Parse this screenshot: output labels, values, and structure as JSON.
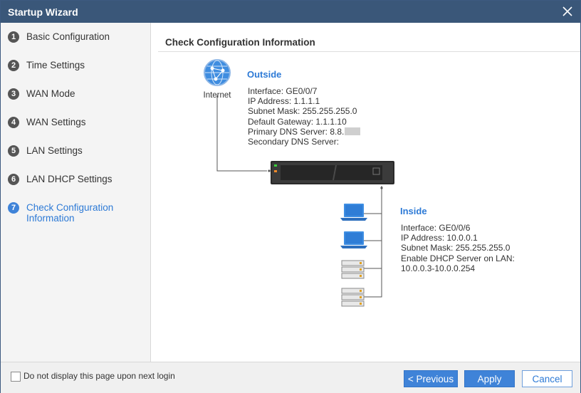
{
  "window": {
    "title": "Startup Wizard"
  },
  "steps": [
    {
      "num": "1",
      "label": "Basic Configuration"
    },
    {
      "num": "2",
      "label": "Time Settings"
    },
    {
      "num": "3",
      "label": "WAN Mode"
    },
    {
      "num": "4",
      "label": "WAN Settings"
    },
    {
      "num": "5",
      "label": "LAN Settings"
    },
    {
      "num": "6",
      "label": "LAN DHCP Settings"
    },
    {
      "num": "7",
      "label": "Check Configuration Information",
      "active": true
    }
  ],
  "main": {
    "section_title": "Check Configuration Information",
    "internet_label": "Internet",
    "outside": {
      "heading": "Outside",
      "interface": "Interface: GE0/0/7",
      "ip": "IP Address: 1.1.1.1",
      "mask": "Subnet Mask: 255.255.255.0",
      "gateway": "Default Gateway: 1.1.1.10",
      "primary_dns": "Primary DNS Server: 8.8.",
      "secondary_dns": "Secondary DNS Server:"
    },
    "inside": {
      "heading": "Inside",
      "interface": "Interface: GE0/0/6",
      "ip": "IP Address: 10.0.0.1",
      "mask": "Subnet Mask: 255.255.255.0",
      "dhcp": "Enable DHCP Server on LAN:",
      "range": "10.0.0.3-10.0.0.254"
    }
  },
  "footer": {
    "dont_show_label": "Do not display this page upon next login",
    "previous_label": "< Previous",
    "apply_label": "Apply",
    "cancel_label": "Cancel"
  },
  "colors": {
    "titlebar": "#3a5779",
    "accent": "#3f83d8",
    "link": "#2d7ad6"
  },
  "icons": {
    "close": "close-icon",
    "internet": "globe-icon",
    "device": "firewall-device-icon",
    "laptop": "laptop-icon",
    "server": "server-icon"
  }
}
